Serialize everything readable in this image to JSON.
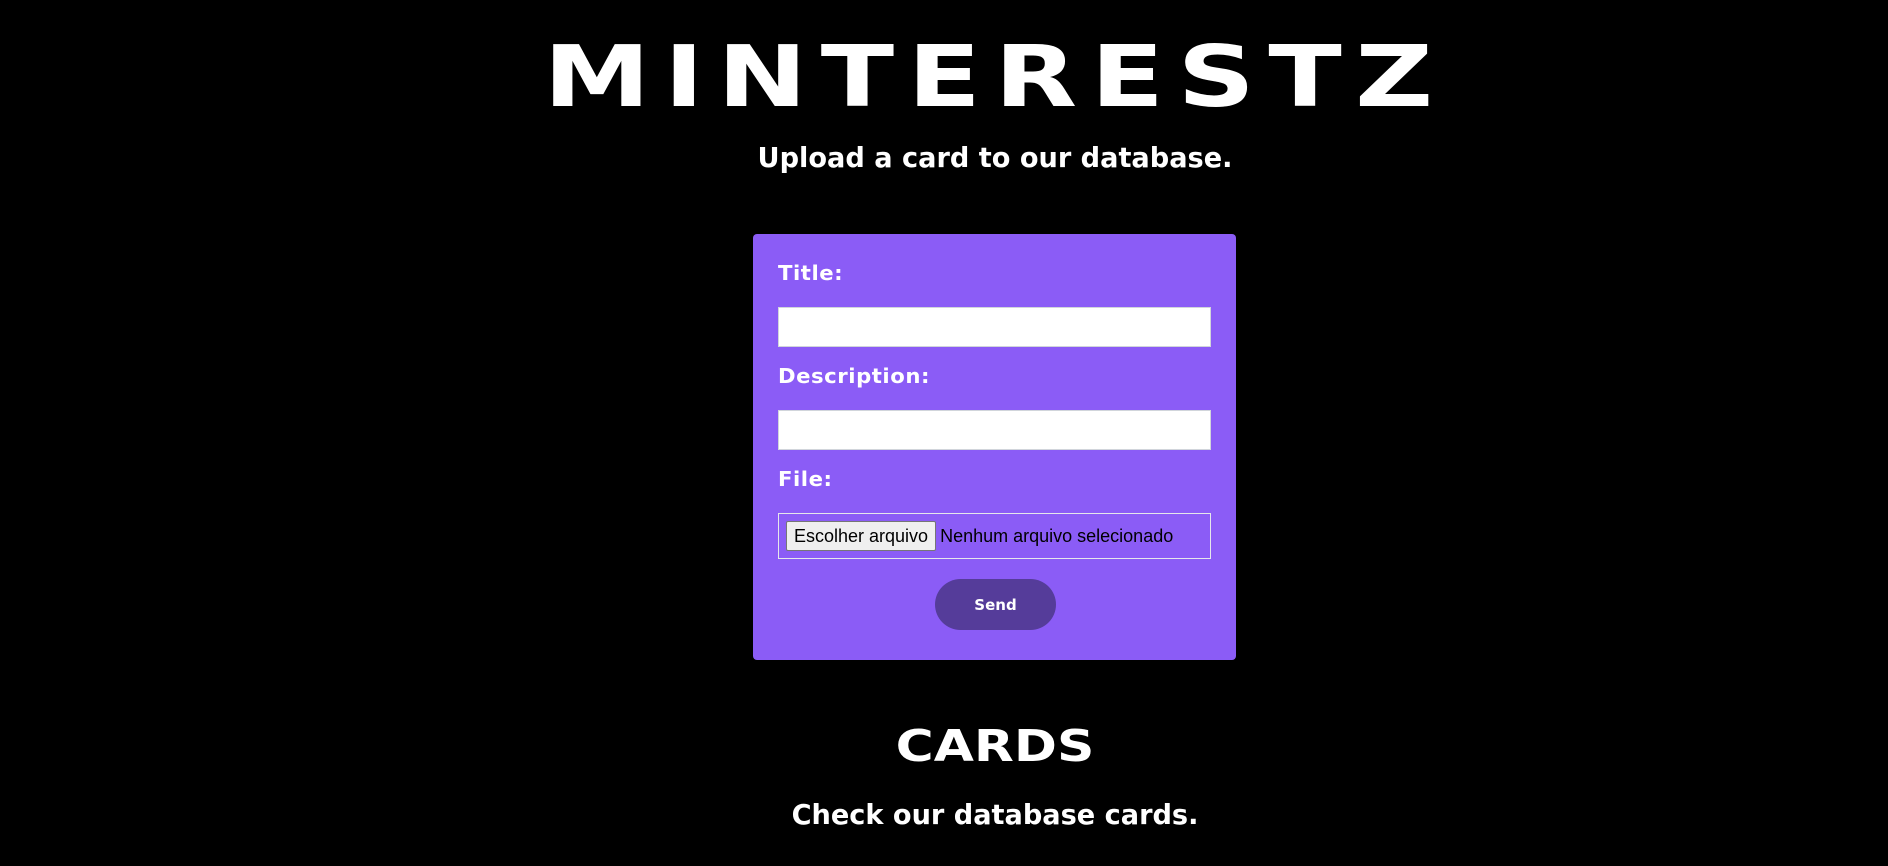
{
  "header": {
    "brand": "MINTERESTZ",
    "subtitle": "Upload a card to our database."
  },
  "form": {
    "title_label": "Title:",
    "title_value": "",
    "description_label": "Description:",
    "description_value": "",
    "file_label": "File:",
    "file_button_label": "Escolher arquivo",
    "file_status": "Nenhum arquivo selecionado",
    "send_label": "Send"
  },
  "cards_section": {
    "title": "CARDS",
    "subtitle": "Check our database cards."
  },
  "colors": {
    "background": "#000000",
    "form_background": "#8b5cf6",
    "send_button": "#553c9a",
    "text": "#ffffff"
  }
}
